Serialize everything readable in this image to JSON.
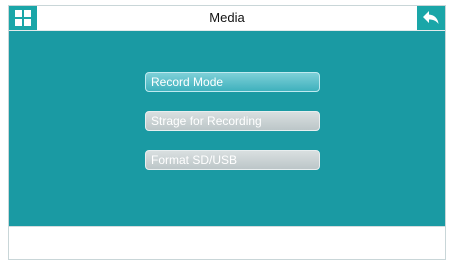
{
  "header": {
    "title": "Media",
    "left_icon": "grid-icon",
    "right_icon": "back-arrow-icon"
  },
  "menu": {
    "items": [
      {
        "label": "Record Mode",
        "selected": true
      },
      {
        "label": "Strage for Recording",
        "selected": false
      },
      {
        "label": "Format SD/USB",
        "selected": false
      }
    ]
  },
  "colors": {
    "background_teal": "#1a9aa3",
    "accent": "#1aa6a8",
    "selected_item": "#4fb8c3",
    "item_gray": "#c7cfd1"
  }
}
